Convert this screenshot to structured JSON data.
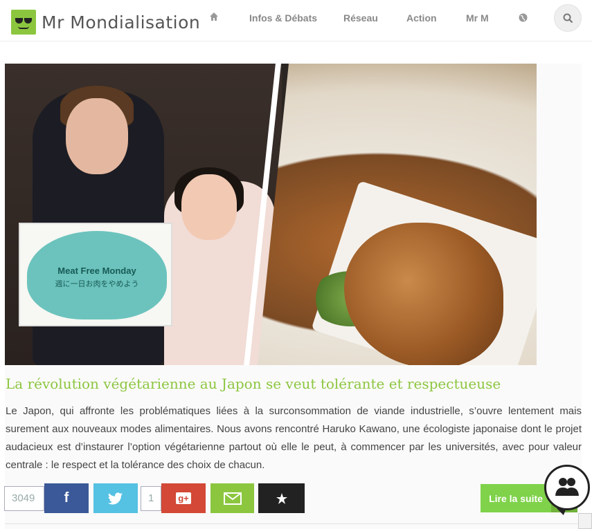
{
  "brand": {
    "name": "Mr Mondialisation",
    "accent": "#8cc63f"
  },
  "nav": {
    "home_icon": "home-icon",
    "items": [
      "Infos & Débats",
      "Réseau",
      "Action",
      "Mr M"
    ],
    "globe_icon": "globe-icon",
    "search_icon": "search-icon"
  },
  "article": {
    "image": {
      "sign_title": "Meat Free Monday",
      "sign_subtitle": "週に一日お肉をやめよう"
    },
    "title": "La révolution végétarienne au Japon se veut tolérante et respectueuse",
    "excerpt": "Le Japon, qui affronte les problématiques liées à la surconsommation de viande industrielle, s’ouvre lentement mais surement aux nouveaux modes alimentaires. Nous avons rencontré Haruko Kawano, une écologiste japonaise dont le projet audacieux est d’instaurer l’option végétarienne partout où elle le peut, à commencer par les universités, avec pour valeur centrale : le respect et la tolérance des choix de chacun.",
    "read_more": "Lire la suite"
  },
  "share": {
    "facebook_count": "3049",
    "google_count": "1",
    "facebook_glyph": "f",
    "google_glyph": "g+",
    "colors": {
      "facebook": "#3b5998",
      "twitter": "#55c1e3",
      "google": "#d34836",
      "mail": "#8cc63f",
      "star": "#222222"
    }
  }
}
